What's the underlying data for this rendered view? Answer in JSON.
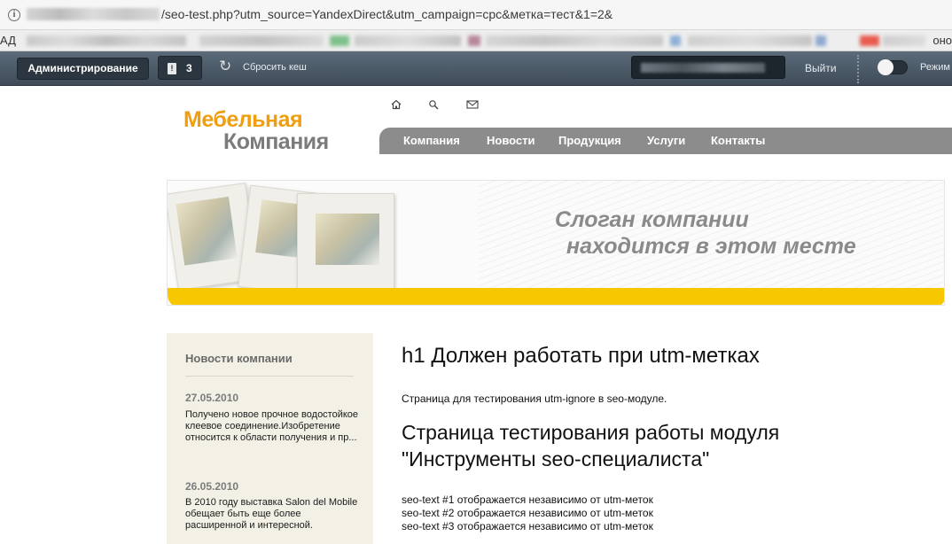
{
  "browser": {
    "url_visible": "/seo-test.php?utm_source=YandexDirect&utm_campaign=cpc&метка=тест&1=2&",
    "bookmarks_left": "АД",
    "bookmarks_right": "оно"
  },
  "admin": {
    "admin_button": "Администрирование",
    "notifications_count": "3",
    "reset_cache": "Сбросить кеш",
    "logout": "Выйти",
    "mode_label": "Режим"
  },
  "site": {
    "logo_line1": "Мебельная",
    "logo_line2": "Компания",
    "icons": [
      "home-icon",
      "search-icon",
      "mail-icon"
    ],
    "nav": [
      "Компания",
      "Новости",
      "Продукция",
      "Услуги",
      "Контакты"
    ],
    "slogan_line1": "Слоган компании",
    "slogan_line2": "находится в этом месте"
  },
  "sidebar": {
    "title": "Новости компании",
    "news": [
      {
        "date": "27.05.2010",
        "text": "Получено новое прочное водостойкое клеевое соединение.Изобретение относится к области получения и пр..."
      },
      {
        "date": "26.05.2010",
        "text": "В 2010 году выставка Salon del Mobile обещает быть еще более расширенной и интересной."
      }
    ]
  },
  "content": {
    "h1": "h1 Должен работать при utm-метках",
    "intro": "Страница для тестирования utm-ignore в seo-модуле.",
    "h2_line1": "Страница тестирования работы модуля",
    "h2_line2": "\"Инструменты seo-специалиста\"",
    "seo_texts": [
      "seo-text #1 отображается независимо от utm-меток",
      "seo-text #2 отображается независимо от utm-меток",
      "seo-text #3 отображается независимо от utm-меток"
    ]
  }
}
